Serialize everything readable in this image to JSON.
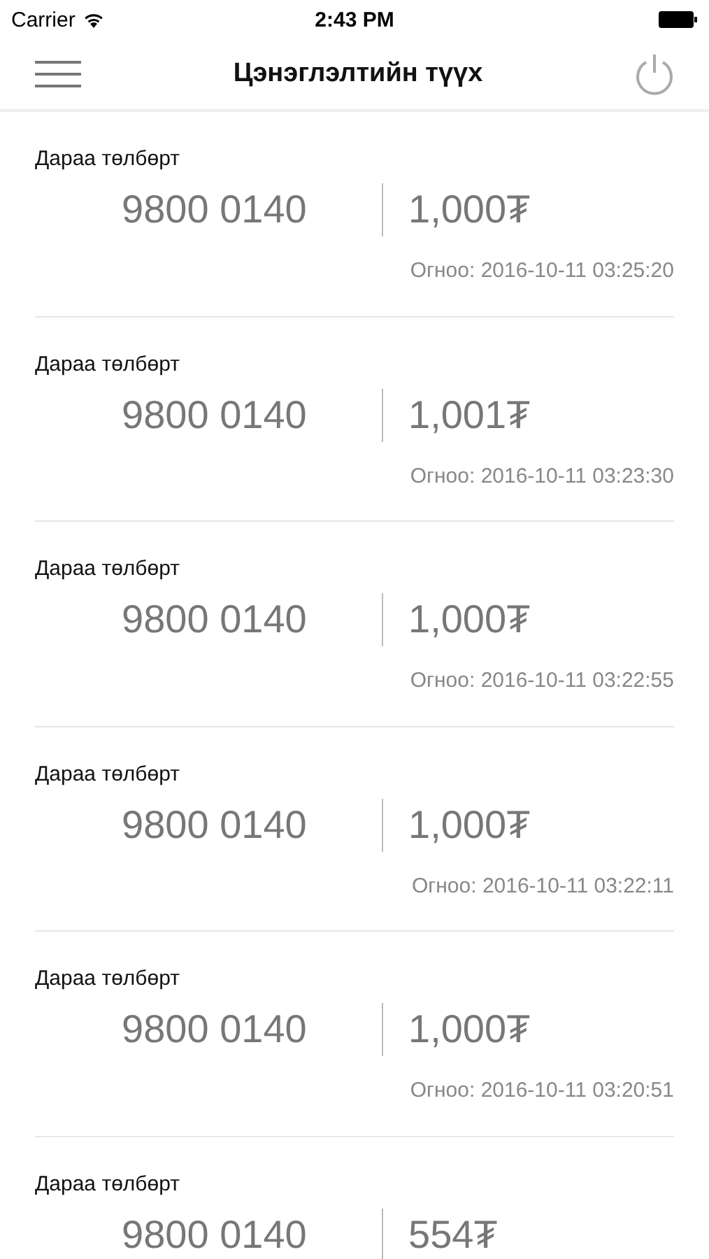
{
  "status_bar": {
    "carrier": "Carrier",
    "time": "2:43 PM"
  },
  "nav_bar": {
    "title": "Цэнэглэлтийн түүх"
  },
  "entries": [
    {
      "type": "Дараа төлбөрт",
      "number": "9800 0140",
      "amount": "1,000₮",
      "date": "Огноо: 2016-10-11 03:25:20"
    },
    {
      "type": "Дараа төлбөрт",
      "number": "9800 0140",
      "amount": "1,001₮",
      "date": "Огноо: 2016-10-11 03:23:30"
    },
    {
      "type": "Дараа төлбөрт",
      "number": "9800 0140",
      "amount": "1,000₮",
      "date": "Огноо: 2016-10-11 03:22:55"
    },
    {
      "type": "Дараа төлбөрт",
      "number": "9800 0140",
      "amount": "1,000₮",
      "date": "Огноо: 2016-10-11 03:22:11"
    },
    {
      "type": "Дараа төлбөрт",
      "number": "9800 0140",
      "amount": "1,000₮",
      "date": "Огноо: 2016-10-11 03:20:51"
    },
    {
      "type": "Дараа төлбөрт",
      "number": "9800 0140",
      "amount": "554₮"
    }
  ]
}
